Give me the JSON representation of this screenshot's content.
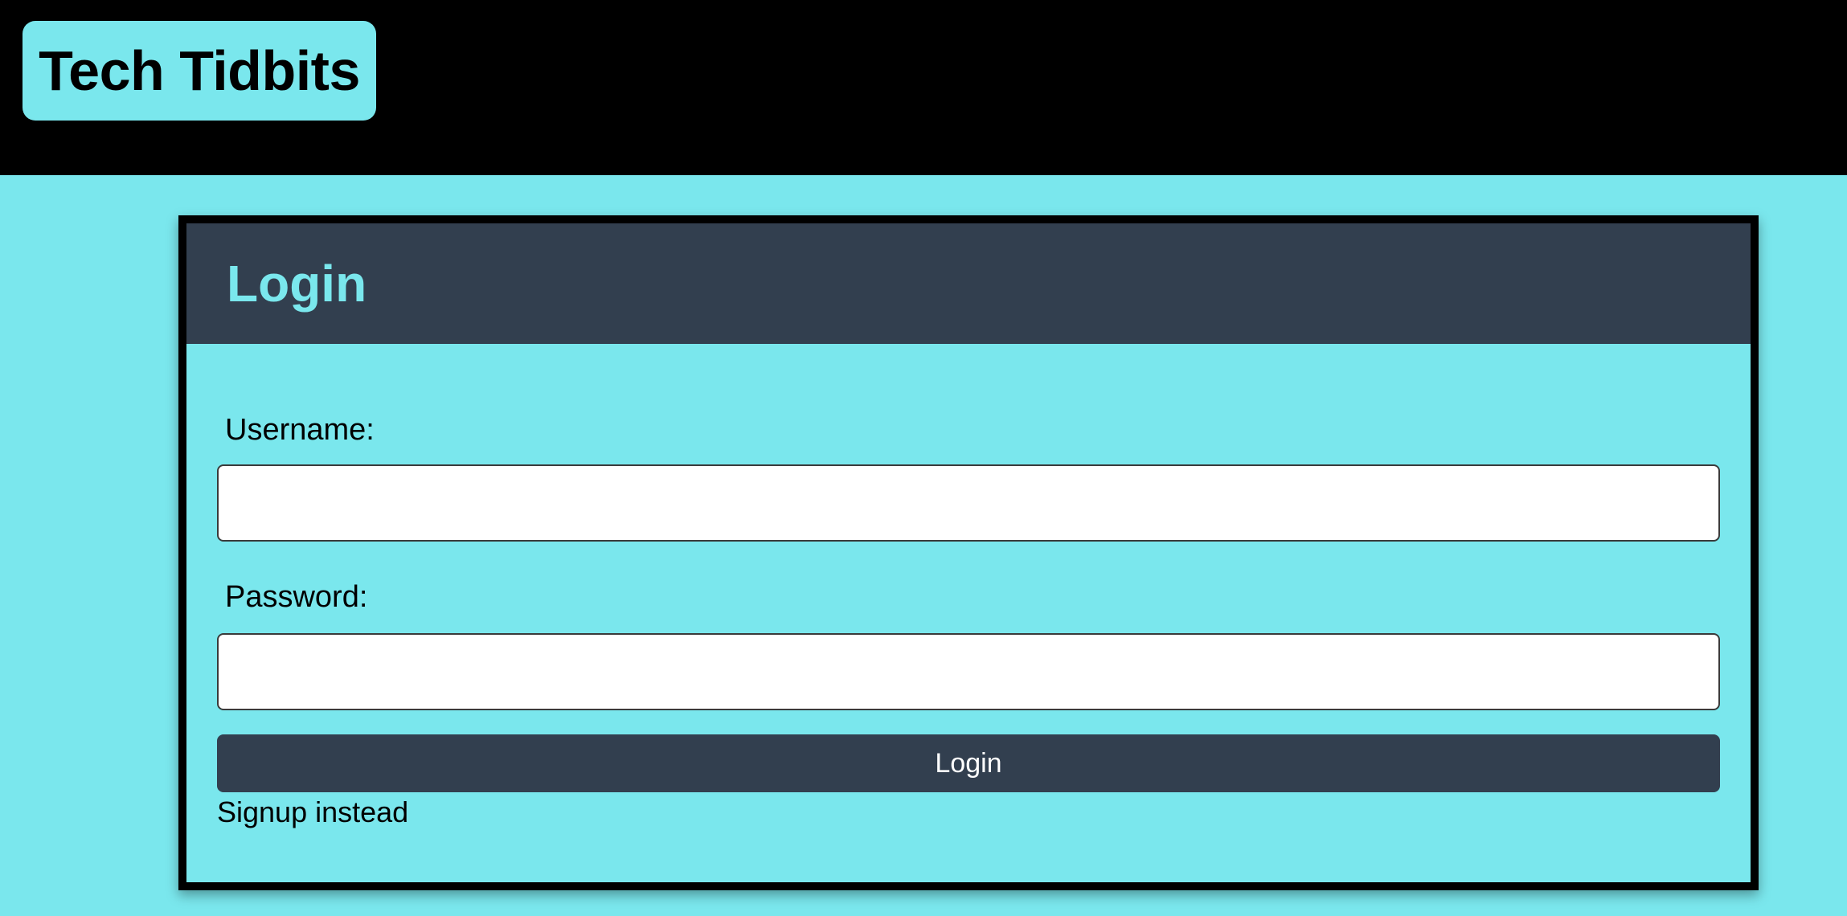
{
  "header": {
    "brand": "Tech Tidbits"
  },
  "login_card": {
    "title": "Login",
    "username_label": "Username:",
    "username_value": "",
    "password_label": "Password:",
    "password_value": "",
    "submit_label": "Login",
    "signup_link": "Signup instead"
  },
  "colors": {
    "accent": "#7ae7ed",
    "dark": "#323f4f",
    "header_bg": "#000000"
  }
}
